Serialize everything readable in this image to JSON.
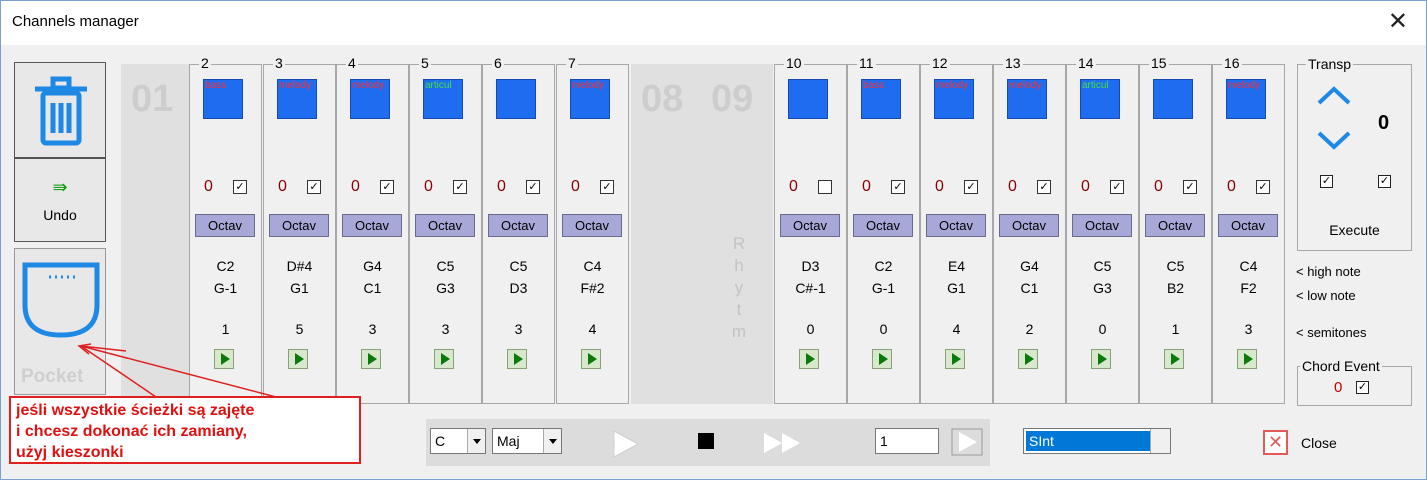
{
  "window": {
    "title": "Channels manager",
    "close_glyph": "✕"
  },
  "tools": {
    "undo_label": "Undo",
    "undo_arrow": "⇛",
    "pocket_label": "Pocket"
  },
  "disabled": {
    "ch01": "01",
    "ch08": "08",
    "ch09": "09",
    "rhythm_letters": [
      "R",
      "h",
      "y",
      "t",
      "m"
    ]
  },
  "octav_label": "Octav",
  "channels": [
    {
      "num": "2",
      "tag": "bass",
      "tag_color": "red",
      "instrument": "bass-instrument",
      "zero": "0",
      "check": "✓",
      "high": "C2",
      "low": "G-1",
      "semi": "1"
    },
    {
      "num": "3",
      "tag": "melody",
      "tag_color": "red",
      "instrument": "guitar",
      "zero": "0",
      "check": "✓",
      "high": "D#4",
      "low": "G1",
      "semi": "5"
    },
    {
      "num": "4",
      "tag": "melody",
      "tag_color": "red",
      "instrument": "guitar",
      "zero": "0",
      "check": "✓",
      "high": "G4",
      "low": "C1",
      "semi": "3"
    },
    {
      "num": "5",
      "tag": "articul",
      "tag_color": "green",
      "instrument": "articulation-grid",
      "zero": "0",
      "check": "✓",
      "high": "C5",
      "low": "G3",
      "semi": "3"
    },
    {
      "num": "6",
      "tag": "",
      "tag_color": "red",
      "instrument": "guitar",
      "zero": "0",
      "check": "✓",
      "high": "C5",
      "low": "D3",
      "semi": "3"
    },
    {
      "num": "7",
      "tag": "melody",
      "tag_color": "red",
      "instrument": "guitar",
      "zero": "0",
      "check": "✓",
      "high": "C4",
      "low": "F#2",
      "semi": "4"
    },
    {
      "num": "10",
      "tag": "",
      "tag_color": "red",
      "instrument": "drums",
      "zero": "0",
      "check": "",
      "high": "D3",
      "low": "C#-1",
      "semi": "0"
    },
    {
      "num": "11",
      "tag": "bass",
      "tag_color": "red",
      "instrument": "bass-instrument",
      "zero": "0",
      "check": "✓",
      "high": "C2",
      "low": "G-1",
      "semi": "0"
    },
    {
      "num": "12",
      "tag": "melody",
      "tag_color": "red",
      "instrument": "guitar",
      "zero": "0",
      "check": "✓",
      "high": "E4",
      "low": "G1",
      "semi": "4"
    },
    {
      "num": "13",
      "tag": "melody",
      "tag_color": "red",
      "instrument": "guitar",
      "zero": "0",
      "check": "✓",
      "high": "G4",
      "low": "C1",
      "semi": "2"
    },
    {
      "num": "14",
      "tag": "articul",
      "tag_color": "green",
      "instrument": "articulation-grid",
      "zero": "0",
      "check": "✓",
      "high": "C5",
      "low": "G3",
      "semi": "0"
    },
    {
      "num": "15",
      "tag": "",
      "tag_color": "red",
      "instrument": "guitar",
      "zero": "0",
      "check": "✓",
      "high": "C5",
      "low": "B2",
      "semi": "1"
    },
    {
      "num": "16",
      "tag": "melody",
      "tag_color": "red",
      "instrument": "guitar",
      "zero": "0",
      "check": "✓",
      "high": "C4",
      "low": "F2",
      "semi": "3"
    }
  ],
  "transp": {
    "label": "Transp",
    "value": "0",
    "check1": "✓",
    "check2": "✓",
    "execute": "Execute"
  },
  "legend": {
    "high": "< high note",
    "low": "< low note",
    "semi": "< semitones"
  },
  "chord_event": {
    "label": "Chord Event",
    "zero": "0",
    "check": "✓"
  },
  "annotation": {
    "lines": [
      "jeśli wszystkie ścieżki są zajęte",
      "i chcesz dokonać ich zamiany,",
      "użyj kieszonki"
    ]
  },
  "transport": {
    "key": "C",
    "mode": "Maj",
    "number": "1",
    "synth": "SInt"
  },
  "close_label": "Close",
  "colors": {
    "accent_blue": "#1e88e5",
    "selected_blue": "#0078d7",
    "annot_red": "#e01010",
    "octav_bg": "#a8a8d8"
  }
}
